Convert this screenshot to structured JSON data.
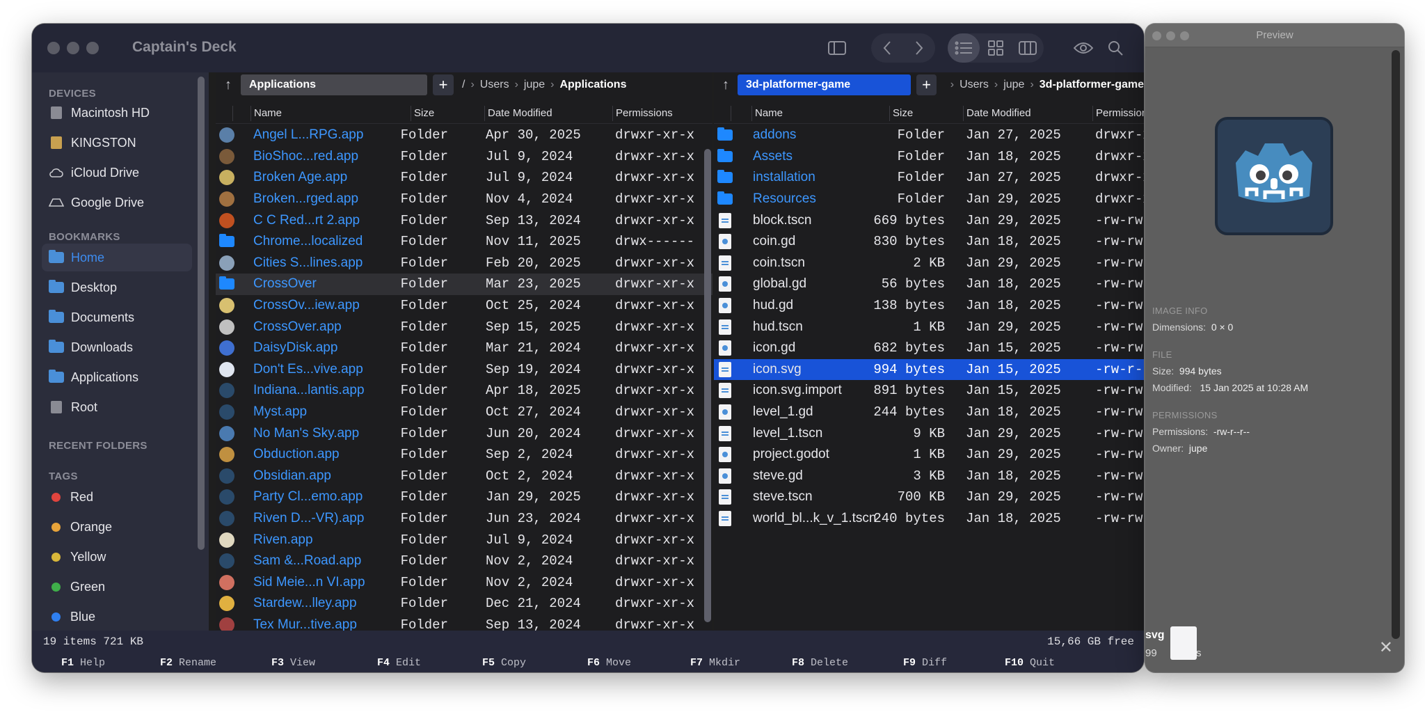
{
  "window": {
    "title": "Captain's Deck"
  },
  "sidebar": {
    "devices_heading": "DEVICES",
    "devices": [
      {
        "label": "Macintosh HD",
        "icon": "disk-icon"
      },
      {
        "label": "KINGSTON",
        "icon": "usb-drive-icon"
      },
      {
        "label": "iCloud Drive",
        "icon": "cloud-icon"
      },
      {
        "label": "Google Drive",
        "icon": "drive-icon"
      }
    ],
    "bookmarks_heading": "BOOKMARKS",
    "bookmarks": [
      {
        "label": "Home",
        "selected": true
      },
      {
        "label": "Desktop"
      },
      {
        "label": "Documents"
      },
      {
        "label": "Downloads"
      },
      {
        "label": "Applications"
      },
      {
        "label": "Root"
      }
    ],
    "recent_heading": "RECENT FOLDERS",
    "tags_heading": "TAGS",
    "tags": [
      {
        "label": "Red",
        "color": "#e0443e"
      },
      {
        "label": "Orange",
        "color": "#e8a33a"
      },
      {
        "label": "Yellow",
        "color": "#d9b73a"
      },
      {
        "label": "Green",
        "color": "#3fae4a"
      },
      {
        "label": "Blue",
        "color": "#2f7ff0"
      }
    ]
  },
  "left_pane": {
    "tab": "Applications",
    "crumbs": [
      "/",
      "Users",
      "jupe",
      "Applications"
    ],
    "columns": {
      "name": "Name",
      "size": "Size",
      "date": "Date Modified",
      "perm": "Permissions"
    },
    "rows": [
      {
        "name": "Angel L...RPG.app",
        "size": "Folder",
        "date": "Apr 30, 2025",
        "perm": "drwxr-xr-x",
        "color": "#5a7fa8"
      },
      {
        "name": "BioShoc...red.app",
        "size": "Folder",
        "date": "Jul 9, 2024",
        "perm": "drwxr-xr-x",
        "color": "#7a5a3a"
      },
      {
        "name": "Broken Age.app",
        "size": "Folder",
        "date": "Jul 9, 2024",
        "perm": "drwxr-xr-x",
        "color": "#c8b060"
      },
      {
        "name": "Broken...rged.app",
        "size": "Folder",
        "date": "Nov 4, 2024",
        "perm": "drwxr-xr-x",
        "color": "#a07040"
      },
      {
        "name": "C C Red...rt 2.app",
        "size": "Folder",
        "date": "Sep 13, 2024",
        "perm": "drwxr-xr-x",
        "color": "#c05020"
      },
      {
        "name": "Chrome...localized",
        "size": "Folder",
        "date": "Nov 11, 2025",
        "perm": "drwx------",
        "color": "folder"
      },
      {
        "name": "Cities S...lines.app",
        "size": "Folder",
        "date": "Feb 20, 2025",
        "perm": "drwxr-xr-x",
        "color": "#8aa0b8"
      },
      {
        "name": "CrossOver",
        "size": "Folder",
        "date": "Mar 23, 2025",
        "perm": "drwxr-xr-x",
        "color": "folder",
        "highlight": true
      },
      {
        "name": "CrossOv...iew.app",
        "size": "Folder",
        "date": "Oct 25, 2024",
        "perm": "drwxr-xr-x",
        "color": "#d8c070"
      },
      {
        "name": "CrossOver.app",
        "size": "Folder",
        "date": "Sep 15, 2025",
        "perm": "drwxr-xr-x",
        "color": "#c0c0c0"
      },
      {
        "name": "DaisyDisk.app",
        "size": "Folder",
        "date": "Mar 21, 2024",
        "perm": "drwxr-xr-x",
        "color": "#3f6fd0"
      },
      {
        "name": "Don't Es...vive.app",
        "size": "Folder",
        "date": "Sep 19, 2024",
        "perm": "drwxr-xr-x",
        "color": "#e0e6f0"
      },
      {
        "name": "Indiana...lantis.app",
        "size": "Folder",
        "date": "Apr 18, 2025",
        "perm": "drwxr-xr-x",
        "color": "#2a4a6a"
      },
      {
        "name": "Myst.app",
        "size": "Folder",
        "date": "Oct 27, 2024",
        "perm": "drwxr-xr-x",
        "color": "#2a4a6a"
      },
      {
        "name": "No Man's Sky.app",
        "size": "Folder",
        "date": "Jun 20, 2024",
        "perm": "drwxr-xr-x",
        "color": "#4a7ab0"
      },
      {
        "name": "Obduction.app",
        "size": "Folder",
        "date": "Sep 2, 2024",
        "perm": "drwxr-xr-x",
        "color": "#c09040"
      },
      {
        "name": "Obsidian.app",
        "size": "Folder",
        "date": "Oct 2, 2024",
        "perm": "drwxr-xr-x",
        "color": "#2a4a6a"
      },
      {
        "name": "Party Cl...emo.app",
        "size": "Folder",
        "date": "Jan 29, 2025",
        "perm": "drwxr-xr-x",
        "color": "#2a4a6a"
      },
      {
        "name": "Riven D...-VR).app",
        "size": "Folder",
        "date": "Jun 23, 2024",
        "perm": "drwxr-xr-x",
        "color": "#2a4a6a"
      },
      {
        "name": "Riven.app",
        "size": "Folder",
        "date": "Jul 9, 2024",
        "perm": "drwxr-xr-x",
        "color": "#e0d8c0"
      },
      {
        "name": "Sam &...Road.app",
        "size": "Folder",
        "date": "Nov 2, 2024",
        "perm": "drwxr-xr-x",
        "color": "#2a4a6a"
      },
      {
        "name": "Sid Meie...n VI.app",
        "size": "Folder",
        "date": "Nov 2, 2024",
        "perm": "drwxr-xr-x",
        "color": "#d07060"
      },
      {
        "name": "Stardew...lley.app",
        "size": "Folder",
        "date": "Dec 21, 2024",
        "perm": "drwxr-xr-x",
        "color": "#e0b040"
      },
      {
        "name": "Tex Mur...tive.app",
        "size": "Folder",
        "date": "Sep 13, 2024",
        "perm": "drwxr-xr-x",
        "color": "#a04040"
      }
    ]
  },
  "right_pane": {
    "tab": "3d-platformer-game",
    "crumbs": [
      "Users",
      "jupe",
      "3d-platformer-game"
    ],
    "columns": {
      "name": "Name",
      "size": "Size",
      "date": "Date Modified",
      "perm": "Permissions"
    },
    "rows": [
      {
        "name": "addons",
        "size": "Folder",
        "date": "Jan 27, 2025",
        "perm": "drwxr-xr-x",
        "kind": "folder"
      },
      {
        "name": "Assets",
        "size": "Folder",
        "date": "Jan 18, 2025",
        "perm": "drwxr-xr-x",
        "kind": "folder"
      },
      {
        "name": "installation",
        "size": "Folder",
        "date": "Jan 27, 2025",
        "perm": "drwxr-xr-x",
        "kind": "folder"
      },
      {
        "name": "Resources",
        "size": "Folder",
        "date": "Jan 29, 2025",
        "perm": "drwxr-xr-x",
        "kind": "folder"
      },
      {
        "name": "block.tscn",
        "size": "669 bytes",
        "date": "Jan 29, 2025",
        "perm": "-rw-rw-rw-",
        "kind": "file"
      },
      {
        "name": "coin.gd",
        "size": "830 bytes",
        "date": "Jan 18, 2025",
        "perm": "-rw-rw-rw-",
        "kind": "gd"
      },
      {
        "name": "coin.tscn",
        "size": "2 KB",
        "date": "Jan 29, 2025",
        "perm": "-rw-rw-rw-",
        "kind": "file"
      },
      {
        "name": "global.gd",
        "size": "56 bytes",
        "date": "Jan 18, 2025",
        "perm": "-rw-rw-rw-",
        "kind": "gd"
      },
      {
        "name": "hud.gd",
        "size": "138 bytes",
        "date": "Jan 18, 2025",
        "perm": "-rw-rw-rw-",
        "kind": "gd"
      },
      {
        "name": "hud.tscn",
        "size": "1 KB",
        "date": "Jan 29, 2025",
        "perm": "-rw-rw-rw-",
        "kind": "file"
      },
      {
        "name": "icon.gd",
        "size": "682 bytes",
        "date": "Jan 15, 2025",
        "perm": "-rw-rw-rw-",
        "kind": "gd"
      },
      {
        "name": "icon.svg",
        "size": "994 bytes",
        "date": "Jan 15, 2025",
        "perm": "-rw-r--r--",
        "kind": "file",
        "selected": true
      },
      {
        "name": "icon.svg.import",
        "size": "891 bytes",
        "date": "Jan 15, 2025",
        "perm": "-rw-rw-rw-",
        "kind": "file"
      },
      {
        "name": "level_1.gd",
        "size": "244 bytes",
        "date": "Jan 18, 2025",
        "perm": "-rw-rw-rw-",
        "kind": "gd"
      },
      {
        "name": "level_1.tscn",
        "size": "9 KB",
        "date": "Jan 29, 2025",
        "perm": "-rw-rw-rw-",
        "kind": "file"
      },
      {
        "name": "project.godot",
        "size": "1 KB",
        "date": "Jan 29, 2025",
        "perm": "-rw-rw-rw-",
        "kind": "gd"
      },
      {
        "name": "steve.gd",
        "size": "3 KB",
        "date": "Jan 18, 2025",
        "perm": "-rw-rw-rw-",
        "kind": "gd"
      },
      {
        "name": "steve.tscn",
        "size": "700 KB",
        "date": "Jan 29, 2025",
        "perm": "-rw-rw-rw-",
        "kind": "file"
      },
      {
        "name": "world_bl...k_v_1.tscn",
        "size": "240 bytes",
        "date": "Jan 18, 2025",
        "perm": "-rw-rw-rw-",
        "kind": "file"
      }
    ]
  },
  "status": {
    "left": "19 items   721 KB",
    "right": "15,66 GB free"
  },
  "fkeys": [
    {
      "key": "F1",
      "label": "Help"
    },
    {
      "key": "F2",
      "label": "Rename"
    },
    {
      "key": "F3",
      "label": "View"
    },
    {
      "key": "F4",
      "label": "Edit"
    },
    {
      "key": "F5",
      "label": "Copy"
    },
    {
      "key": "F6",
      "label": "Move"
    },
    {
      "key": "F7",
      "label": "Mkdir"
    },
    {
      "key": "F8",
      "label": "Delete"
    },
    {
      "key": "F9",
      "label": "Diff"
    },
    {
      "key": "F10",
      "label": "Quit"
    }
  ],
  "preview": {
    "title": "Preview",
    "image_info_heading": "IMAGE INFO",
    "dimensions_key": "Dimensions:",
    "dimensions_val": "0 × 0",
    "file_heading": "FILE",
    "size_key": "Size:",
    "size_val": "994 bytes",
    "modified_key": "Modified:",
    "modified_val": "15 Jan 2025 at 10:28 AM",
    "permissions_heading": "PERMISSIONS",
    "permissions_key": "Permissions:",
    "permissions_val": "-rw-r--r--",
    "owner_key": "Owner:",
    "owner_val": "jupe",
    "bottom_label1": "svg",
    "bottom_label2": "99",
    "bottom_label2b": "es"
  }
}
